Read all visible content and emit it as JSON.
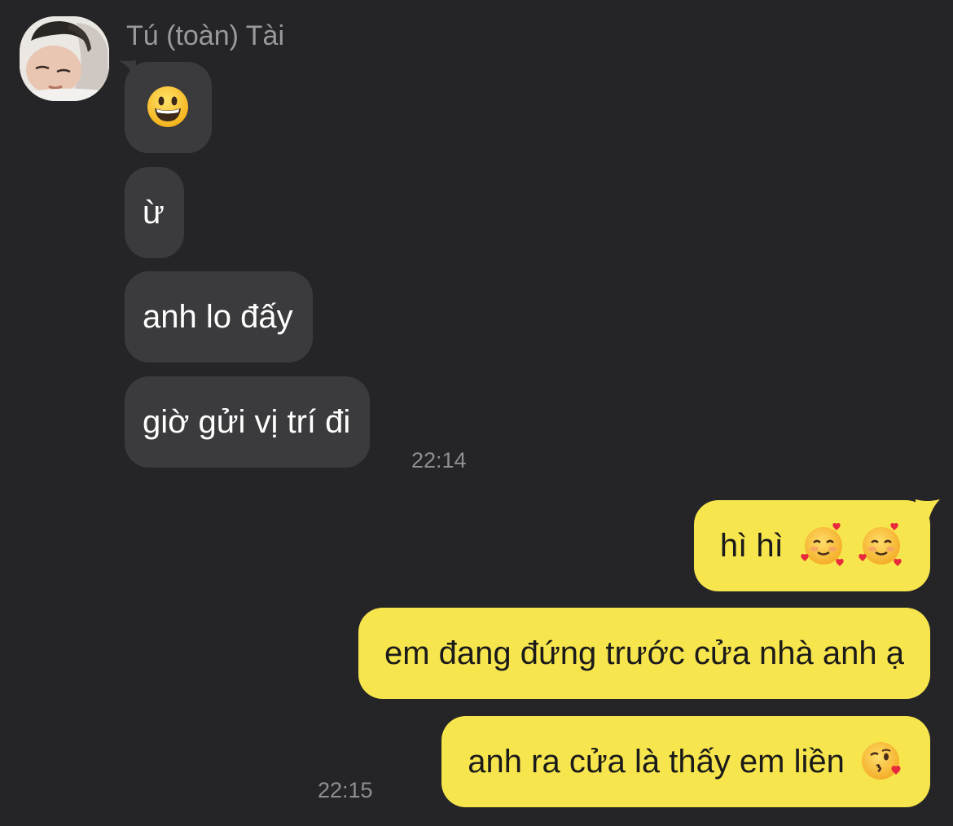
{
  "chat": {
    "incoming": {
      "sender_name": "Tú (toàn) Tài",
      "avatar": "profile-photo",
      "messages": [
        {
          "text": "",
          "emoji": "grinning-face-emoji"
        },
        {
          "text": "ừ"
        },
        {
          "text": "anh lo đấy"
        },
        {
          "text": "giờ gửi vị trí đi"
        }
      ],
      "timestamp": "22:14"
    },
    "outgoing": {
      "messages": [
        {
          "text": "hì hì",
          "emoji": "smiling-face-with-hearts-emoji x2"
        },
        {
          "text": "em đang đứng trước cửa nhà anh ạ"
        },
        {
          "text": "anh ra cửa là thấy em liền",
          "emoji": "face-blowing-kiss-emoji"
        }
      ],
      "timestamp": "22:15"
    }
  },
  "colors": {
    "background": "#252527",
    "incoming_bubble": "#3b3b3e",
    "outgoing_bubble": "#f7e54d",
    "incoming_text": "#ffffff",
    "outgoing_text": "#1a1a1a",
    "meta_text": "#9a9a9e"
  }
}
